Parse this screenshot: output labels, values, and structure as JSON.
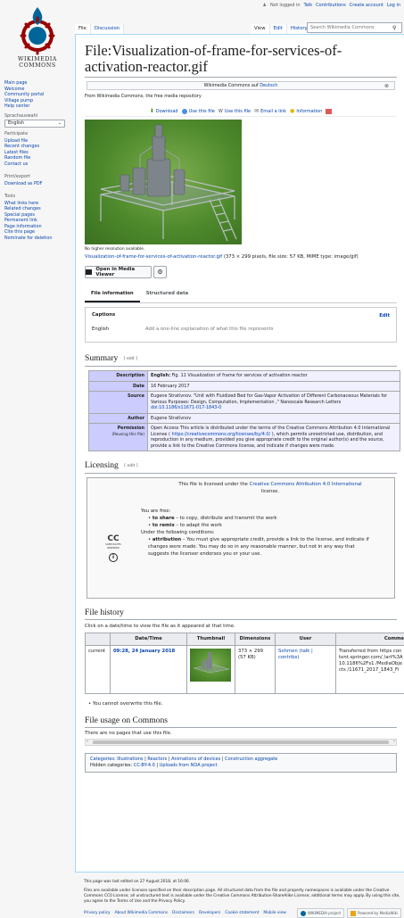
{
  "personal": {
    "not_logged_in": "Not logged in",
    "talk": "Talk",
    "contributions": "Contributions",
    "create_account": "Create account",
    "log_in": "Log in"
  },
  "logo": {
    "line1": "WIKIMEDIA",
    "line2": "COMMONS"
  },
  "sidebar": {
    "main": [
      "Main page",
      "Welcome",
      "Community portal",
      "Village pump",
      "Help center"
    ],
    "language_title": "Sprachauswahl",
    "language_value": "English",
    "participate_title": "Participate",
    "participate": [
      "Upload file",
      "Recent changes",
      "Latest files",
      "Random file",
      "Contact us"
    ],
    "print_title": "Print/export",
    "print": [
      "Download as PDF"
    ],
    "tools_title": "Tools",
    "tools": [
      "What links here",
      "Related changes",
      "Special pages",
      "Permanent link",
      "Page information",
      "Cite this page",
      "Nominate for deletion"
    ]
  },
  "tabs": {
    "file": "File",
    "discussion": "Discussion",
    "view": "View",
    "edit": "Edit",
    "history": "History",
    "search_placeholder": "Search Wikimedia Commons"
  },
  "page": {
    "title": "File:Visualization-of-frame-for-services-of-activation-reactor.gif",
    "notice_prefix": "Wikimedia Commons auf",
    "notice_link": "Deutsch",
    "tagline": "From Wikimedia Commons, the free media repository",
    "actions": [
      "Download",
      "Use this file",
      "Use this file",
      "Email a link",
      "Information"
    ],
    "no_higher": "No higher resolution available.",
    "file_link": "Visualization-of-frame-for-services-of-activation-reactor.gif",
    "file_meta": "(373 × 299 pixels, file size: 57 KB, MIME type: image/gif)",
    "media_viewer": "Open in Media Viewer",
    "file_tabs": [
      "File information",
      "Structured data"
    ],
    "captions_title": "Captions",
    "captions_edit": "Edit",
    "captions_lang": "English",
    "captions_placeholder": "Add a one-line explanation of what this file represents"
  },
  "summary": {
    "heading": "Summary",
    "edit": "[ edit ]",
    "description_k": "Description",
    "description_lang": "English:",
    "description_v": "Fig. 11 Visualization of frame for services of activation reactor",
    "date_k": "Date",
    "date_v": "16 February 2017",
    "source_k": "Source",
    "source_v": "Eugene Stratívnov. \"Unit with Fluidized Bed for Gas-Vapor Activation of Different Carbonaceous Materials for Various Purposes: Design, Computation, Implementation ,\" Nanoscale Research Letters",
    "source_doi": "doi:10.1186/s11671-017-1843-0",
    "author_k": "Author",
    "author_v": "Eugene Stratívnov",
    "permission_k": "Permission",
    "permission_sub": "(Reusing this file)",
    "permission_v1": "Open Access This article is distributed under the terms of the Creative Commons Attribution 4.0 International License (",
    "permission_link": "https://creativecommons.org/licenses/by/4.0/",
    "permission_v2": "), which permits unrestricted use, distribution, and reproduction in any medium, provided you give appropriate credit to the original author(s) and the source, provide a link to the Creative Commons license, and indicate if changes were made."
  },
  "licensing": {
    "heading": "Licensing",
    "edit": "[ edit ]",
    "intro": "This file is licensed under the",
    "license_name": "Creative Commons Attribution 4.0 International",
    "license_suffix": "license.",
    "some_rights": "SOME RIGHTS RESERVED",
    "you_are_free": "You are free:",
    "share_b": "to share",
    "share_t": "– to copy, distribute and transmit the work",
    "remix_b": "to remix",
    "remix_t": "– to adapt the work",
    "conditions": "Under the following conditions:",
    "attr_b": "attribution",
    "attr_t": "– You must give appropriate credit, provide a link to the license, and indicate if changes were made. You may do so in any reasonable manner, but not in any way that suggests the licensor endorses you or your use."
  },
  "history": {
    "heading": "File history",
    "intro": "Click on a date/time to view the file as it appeared at that time.",
    "cols": [
      "",
      "Date/Time",
      "Thumbnail",
      "Dimensions",
      "User",
      "Comme"
    ],
    "row": {
      "status": "current",
      "datetime": "09:28, 24 January 2018",
      "dimensions": "373 × 299",
      "size": "(57 KB)",
      "user": "Sohmen",
      "user_links": "(talk | contribs)",
      "comment": "Transferred from https content.springer.com/ /art%3A10.1186%2Fs1 /MediaObjects /11671_2017_1843_Fi"
    },
    "cannot_overwrite": "You cannot overwrite this file."
  },
  "usage": {
    "heading": "File usage on Commons",
    "text": "There are no pages that use this file."
  },
  "categories": {
    "label": "Categories:",
    "items": [
      "Illustrations",
      "Reactors",
      "Animations of devices",
      "Construction aggregate"
    ],
    "hidden_label": "Hidden categories:",
    "hidden": [
      "CC-BY-4.0",
      "Uploads from NOA project"
    ]
  },
  "footer": {
    "last_edited": "This page was last edited on 27 August 2018, at 16:06.",
    "license_text": "Files are available under licenses specified on their description page. All structured data from the file and property namespaces is available under the Creative Commons CC0 License; all unstructured text is available under the Creative Commons Attribution-ShareAlike License; additional terms may apply. By using this site, you agree to the Terms of Use and the Privacy Policy.",
    "places": [
      "Privacy policy",
      "About Wikimedia Commons",
      "Disclaimers",
      "Developers",
      "Cookie statement",
      "Mobile view"
    ],
    "badge1": "WIKIMEDIA project",
    "badge2": "Powered by MediaWiki"
  },
  "colors": {
    "link": "#0645ad",
    "border": "#a7d7f9",
    "table_key": "#ccccff",
    "table_val": "#f0f0ff"
  }
}
